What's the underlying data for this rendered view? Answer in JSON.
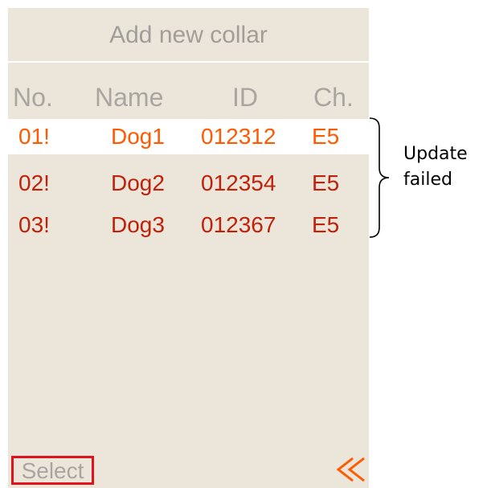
{
  "screen": {
    "title": "Add new collar",
    "colors": {
      "background": "#ece5d9",
      "selected_text": "#ff5a00",
      "failed_text": "#c0210b",
      "muted_text": "#a9a6a1",
      "select_border": "#e0131a"
    }
  },
  "table": {
    "headers": {
      "no": "No.",
      "name": "Name",
      "id": "ID",
      "ch": "Ch."
    },
    "rows": [
      {
        "no": "01!",
        "name": "Dog1",
        "id": "012312",
        "ch": "E5",
        "selected": true
      },
      {
        "no": "02!",
        "name": "Dog2",
        "id": "012354",
        "ch": "E5",
        "selected": false
      },
      {
        "no": "03!",
        "name": "Dog3",
        "id": "012367",
        "ch": "E5",
        "selected": false
      }
    ]
  },
  "footer": {
    "select_label": "Select",
    "back_icon": "double-chevron-left-icon"
  },
  "annotation": {
    "line1": "Update",
    "line2": "failed"
  }
}
